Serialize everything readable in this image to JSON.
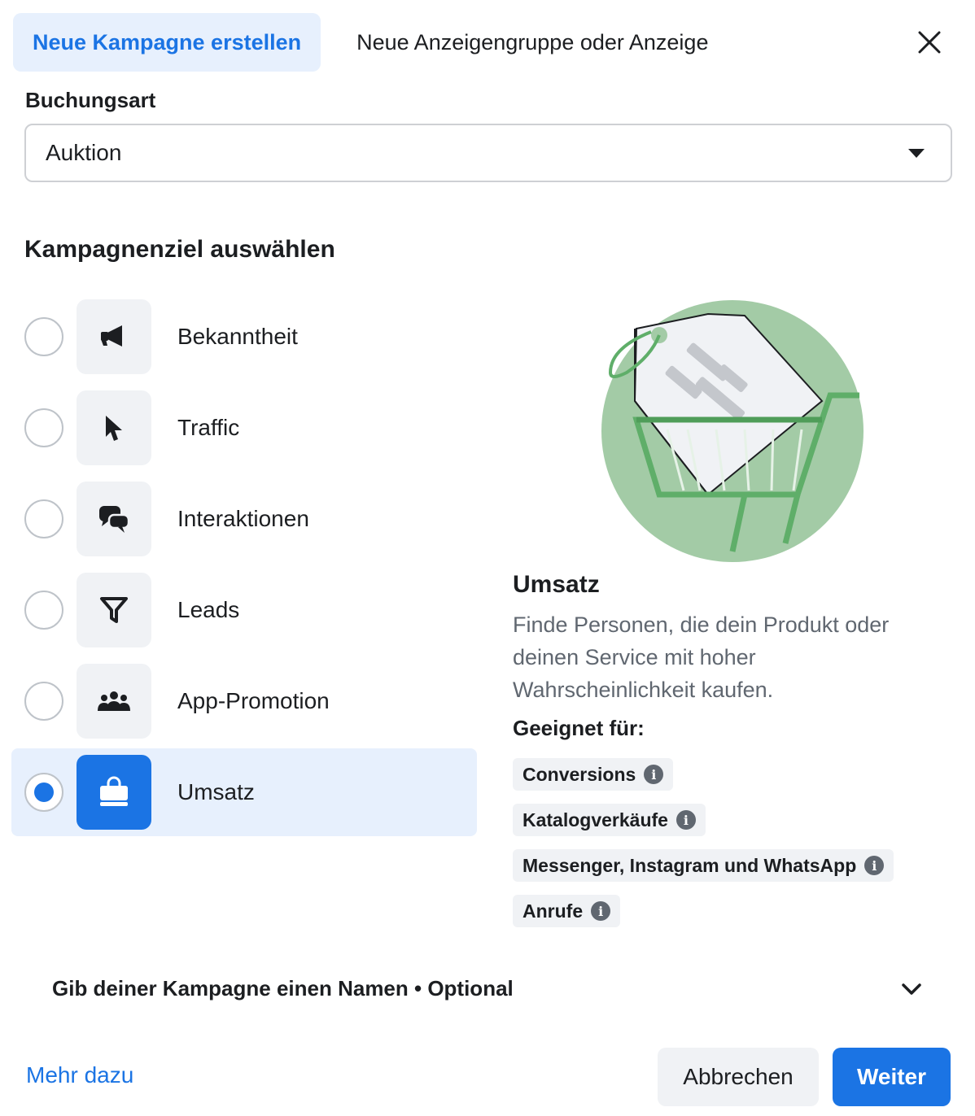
{
  "tabs": {
    "create_campaign": "Neue Kampagne erstellen",
    "existing": "Neue Anzeigengruppe oder Anzeige"
  },
  "buying_type": {
    "label": "Buchungsart",
    "value": "Auktion"
  },
  "objective": {
    "title": "Kampagnenziel auswählen",
    "options": [
      {
        "label": "Bekanntheit",
        "icon": "megaphone-icon",
        "selected": false
      },
      {
        "label": "Traffic",
        "icon": "cursor-icon",
        "selected": false
      },
      {
        "label": "Interaktionen",
        "icon": "chat-bubbles-icon",
        "selected": false
      },
      {
        "label": "Leads",
        "icon": "funnel-icon",
        "selected": false
      },
      {
        "label": "App-Promotion",
        "icon": "people-icon",
        "selected": false
      },
      {
        "label": "Umsatz",
        "icon": "shopping-bag-icon",
        "selected": true
      }
    ]
  },
  "detail": {
    "title": "Umsatz",
    "description": "Finde Personen, die dein Produkt oder deinen Service mit hoher Wahrscheinlichkeit kaufen.",
    "suited_label": "Geeignet für:",
    "tags": [
      "Conversions",
      "Katalogverkäufe",
      "Messenger, Instagram und WhatsApp",
      "Anrufe"
    ]
  },
  "campaign_name": {
    "label": "Gib deiner Kampagne einen Namen • Optional"
  },
  "footer": {
    "learn_more": "Mehr dazu",
    "cancel": "Abbrechen",
    "next": "Weiter"
  },
  "colors": {
    "accent": "#1b74e4",
    "selected_bg": "#e7f0fd",
    "illustration_green": "#a3cba6"
  }
}
